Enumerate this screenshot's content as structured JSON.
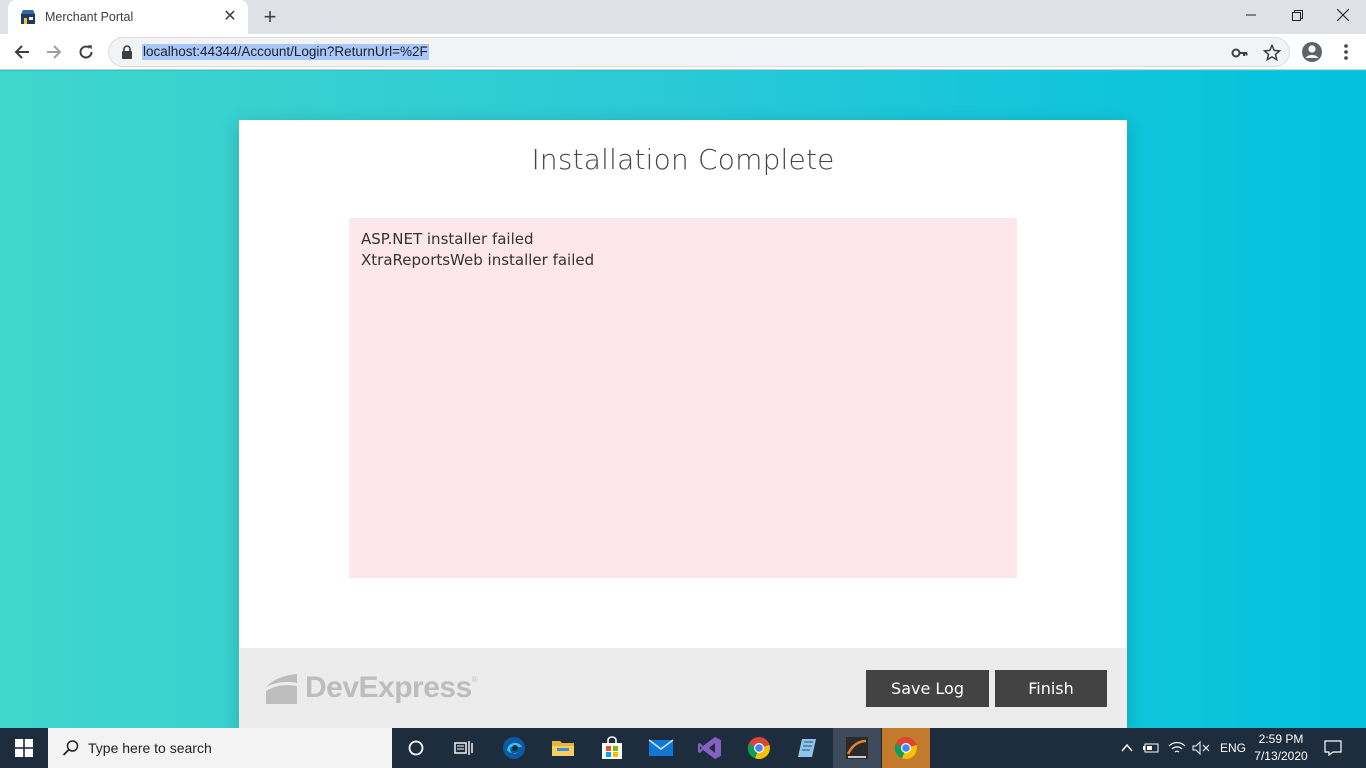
{
  "browser": {
    "tab_title": "Merchant Portal",
    "url": "localhost:44344/Account/Login?ReturnUrl=%2F"
  },
  "dialog": {
    "title": "Installation Complete",
    "log_lines": [
      "ASP.NET installer failed",
      "XtraReportsWeb installer failed"
    ],
    "logo_text": "DevExpress",
    "logo_reg": "®",
    "save_log_label": "Save Log",
    "finish_label": "Finish"
  },
  "taskbar": {
    "search_placeholder": "Type here to search",
    "language": "ENG",
    "time": "2:59 PM",
    "date": "7/13/2020"
  },
  "colors": {
    "page_gradient_start": "#40d6cc",
    "page_gradient_end": "#02c2de",
    "log_background": "#fde6ec",
    "button_background": "#434343",
    "footer_background": "#ececec"
  }
}
